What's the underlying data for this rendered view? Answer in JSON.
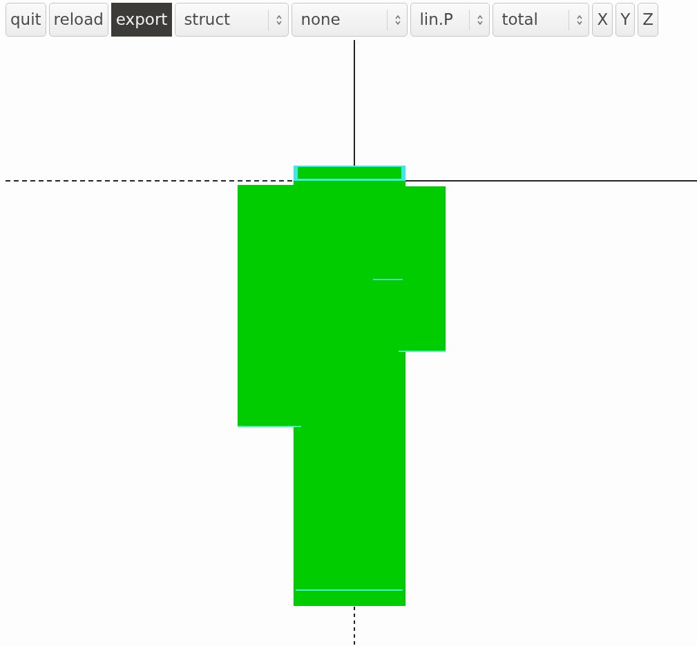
{
  "toolbar": [
    {
      "kind": "button",
      "label": "quit",
      "selected": false
    },
    {
      "kind": "button",
      "label": "reload",
      "selected": false
    },
    {
      "kind": "button",
      "label": "export",
      "selected": true
    },
    {
      "kind": "select",
      "value": "struct"
    },
    {
      "kind": "select",
      "value": "none"
    },
    {
      "kind": "select",
      "value": "lin.P"
    },
    {
      "kind": "select",
      "value": "total"
    },
    {
      "kind": "button",
      "label": "X",
      "selected": false
    },
    {
      "kind": "button",
      "label": "Y",
      "selected": false
    },
    {
      "kind": "button",
      "label": "Z",
      "selected": false
    }
  ]
}
